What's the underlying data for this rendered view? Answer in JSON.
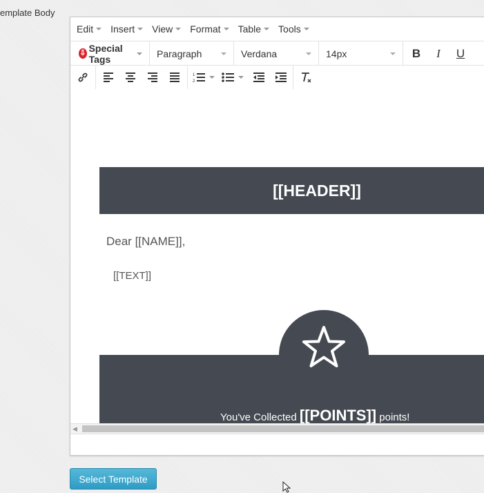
{
  "section_label": "emplate Body",
  "menubar": {
    "items": [
      "Edit",
      "Insert",
      "View",
      "Format",
      "Table",
      "Tools"
    ]
  },
  "toolbar": {
    "special_tags_label": "Special Tags",
    "block_format": "Paragraph",
    "font_family": "Verdana",
    "font_size": "14px",
    "bold_label": "B",
    "italic_label": "I",
    "underline_label": "U"
  },
  "email": {
    "header_placeholder": "[[HEADER]]",
    "greeting": "Dear [[NAME]],",
    "text_placeholder": "[[TEXT]]",
    "points_prefix": "You've Collected",
    "points_value": "[[POINTS]]",
    "points_suffix": "points!"
  },
  "icons": {
    "toolbar": [
      "link-icon",
      "align-left-icon",
      "align-center-icon",
      "align-right-icon",
      "align-justify-icon",
      "numbered-list-icon",
      "bullet-list-icon",
      "outdent-icon",
      "indent-icon",
      "clear-formatting-icon"
    ],
    "content": [
      "star-icon"
    ]
  },
  "colors": {
    "email_band": "#454a52",
    "button": "#3aa7cf",
    "special_tags": "#d9232d"
  },
  "actions": {
    "select_template_label": "Select Template"
  }
}
